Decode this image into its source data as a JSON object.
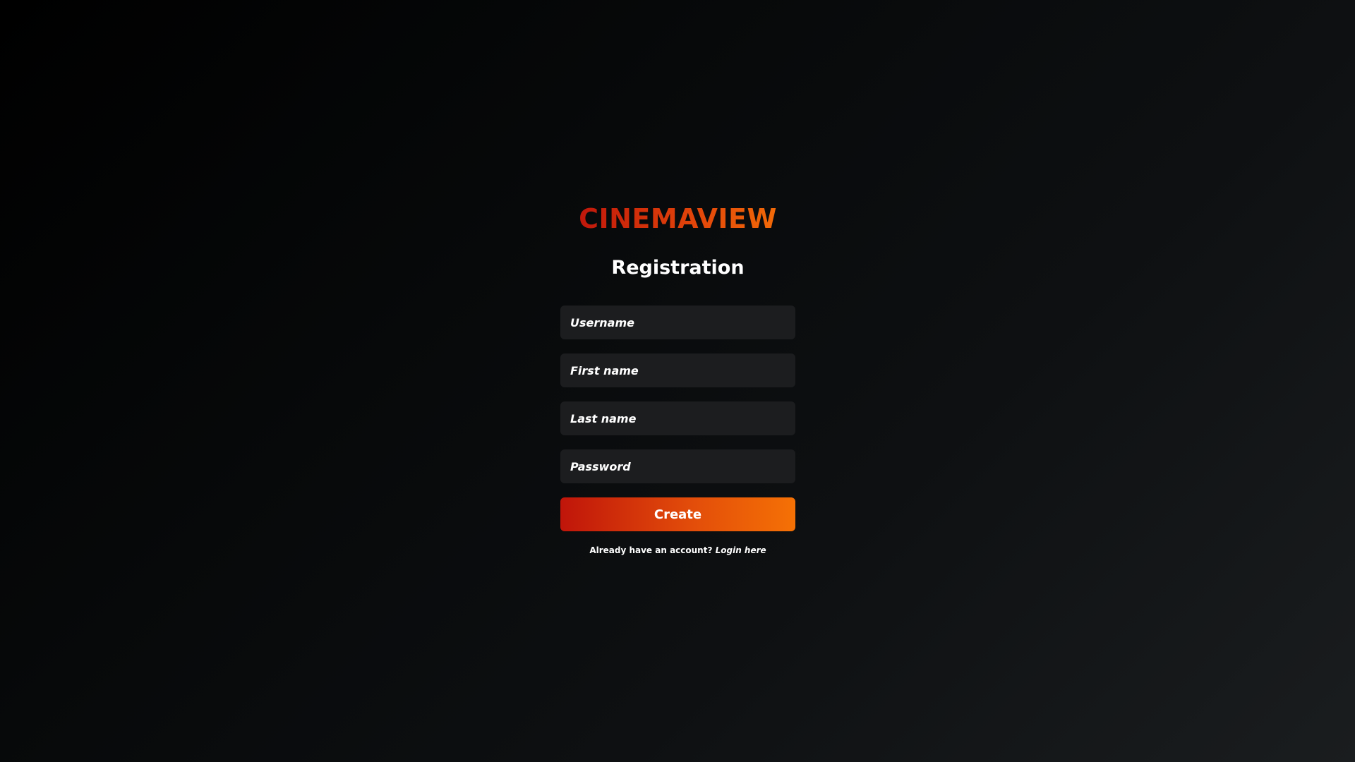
{
  "brand": {
    "logo_text": "CINEMAVIEW",
    "accent_start": "#c0150a",
    "accent_end": "#f57105"
  },
  "page": {
    "heading": "Registration"
  },
  "form": {
    "username_placeholder": "Username",
    "first_name_placeholder": "First name",
    "last_name_placeholder": "Last name",
    "password_placeholder": "Password",
    "submit_label": "Create"
  },
  "footer": {
    "prompt": "Already have an account?",
    "login_link": "Login here"
  }
}
